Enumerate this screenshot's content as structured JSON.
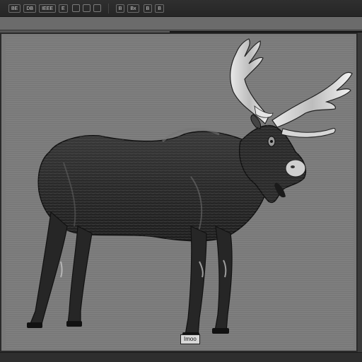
{
  "toolbar": {
    "items": [
      "BE",
      "DB",
      "IEEE",
      "E",
      "B",
      "Bx"
    ],
    "right_items": [
      "B",
      "B"
    ]
  },
  "canvas": {
    "subject": "moose"
  },
  "status": {
    "label": "Imoo"
  }
}
